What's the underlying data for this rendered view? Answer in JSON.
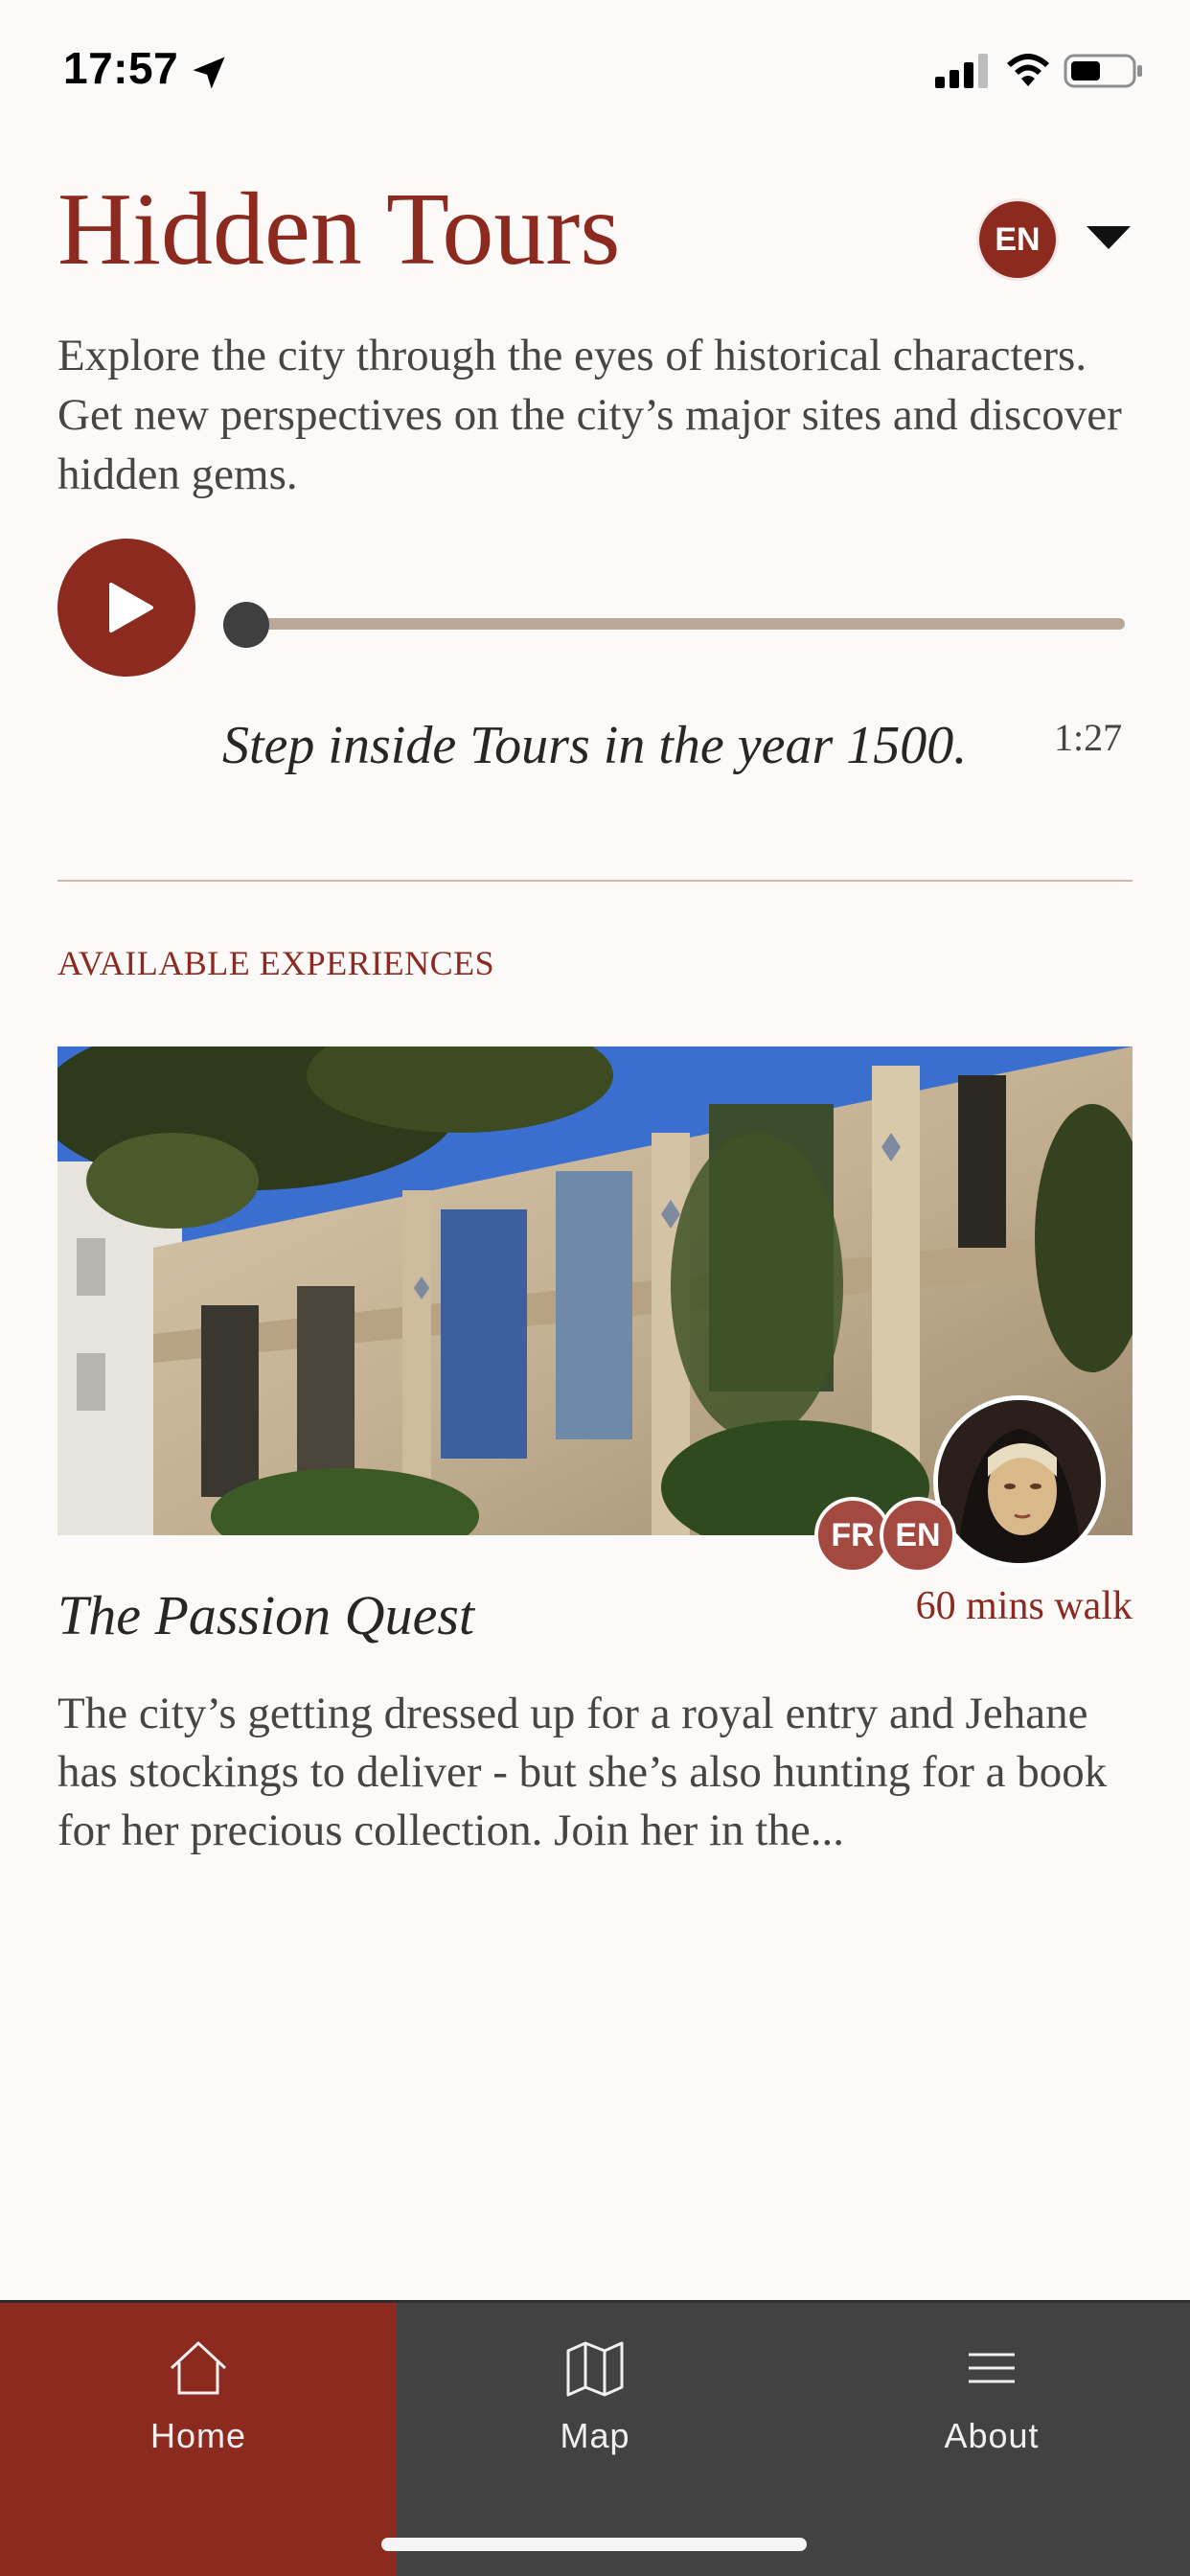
{
  "status_bar": {
    "time": "17:57",
    "icons": [
      "location-arrow-icon",
      "signal-icon",
      "wifi-icon",
      "battery-icon"
    ]
  },
  "header": {
    "title": "Hidden Tours",
    "language_badge": "EN"
  },
  "intro": {
    "text": "Explore the city through the eyes of historical characters. Get new perspectives on the city’s major sites and discover hidden gems."
  },
  "audio_player": {
    "caption": "Step inside Tours in the year 1500.",
    "duration": "1:27",
    "progress": 0
  },
  "section": {
    "label": "AVAILABLE EXPERIENCES"
  },
  "experience": {
    "title": "The Passion Quest",
    "duration": "60 mins walk",
    "languages": [
      "FR",
      "EN"
    ],
    "description": "The city’s getting dressed up for a royal entry and Jehane has stockings to deliver - but she’s also hunting for a book for her precious collection. Join her in the..."
  },
  "tab_bar": {
    "tabs": [
      {
        "label": "Home",
        "icon": "home-icon",
        "active": true
      },
      {
        "label": "Map",
        "icon": "map-icon",
        "active": false
      },
      {
        "label": "About",
        "icon": "menu-icon",
        "active": false
      }
    ]
  },
  "colors": {
    "accent": "#8c2a1f",
    "background": "#fbfaf9",
    "tab_bar": "#424242",
    "text": "#4a4440"
  }
}
